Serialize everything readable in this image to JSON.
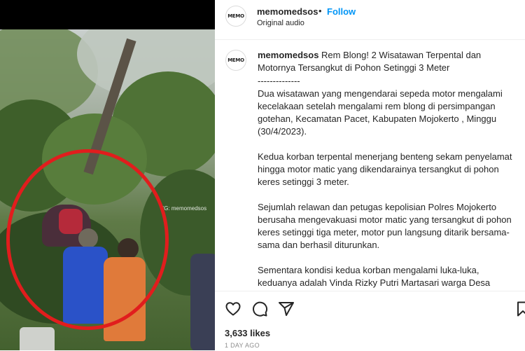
{
  "header": {
    "username": "memomedsos",
    "separator": "•",
    "follow_label": "Follow",
    "audio": "Original audio",
    "avatar_text": "MEMO"
  },
  "media": {
    "watermark": "IG: memomedsos"
  },
  "caption": {
    "username": "memomedsos",
    "title": "Rem Blong! 2 Wisatawan Terpental dan Motornya Tersangkut di Pohon Setinggi 3 Meter",
    "divider": "--------------",
    "paragraphs": [
      "Dua wisatawan yang mengendarai sepeda motor mengalami kecelakaan setelah mengalami rem blong di persimpangan gotehan, Kecamatan Pacet, Kabupaten Mojokerto , Minggu (30/4/2023).",
      "Kedua korban terpental menerjang benteng sekam penyelamat hingga motor matic yang dikendarainya tersangkut di pohon keres setinggi 3 meter.",
      "Sejumlah relawan dan petugas kepolisian Polres Mojokerto berusaha mengevakuasi motor matic yang tersangkut di pohon keres setinggi tiga meter, motor pun langsung ditarik bersama-sama dan berhasil diturunkan.",
      "Sementara kondisi kedua korban mengalami luka-luka, keduanya adalah Vinda Rizky Putri Martasari warga Desa Bendogerit, Kecamatan Sananwetan, Kabupaten Blitar, mengalami luka patah di kaki"
    ]
  },
  "actions": {
    "icons": [
      "heart-icon",
      "comment-icon",
      "share-icon",
      "bookmark-icon"
    ],
    "likes": "3,633 likes",
    "time_ago": "1 DAY AGO"
  },
  "colors": {
    "follow": "#0095f6",
    "circle": "#e11d1d",
    "meta": "#8e8e8e"
  }
}
